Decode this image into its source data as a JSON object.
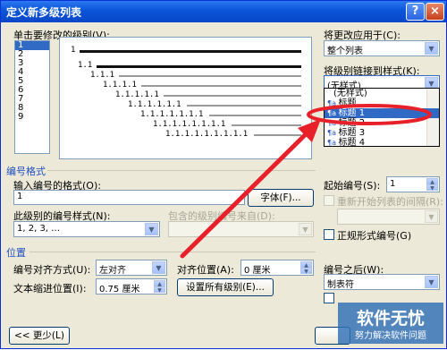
{
  "window": {
    "title": "定义新多级列表",
    "help_label": "?",
    "close_label": "×"
  },
  "level_list": {
    "label": "单击要修改的级别(V):",
    "levels": [
      "1",
      "2",
      "3",
      "4",
      "5",
      "6",
      "7",
      "8",
      "9"
    ],
    "selected": "1"
  },
  "preview": {
    "rows": [
      {
        "text": "1"
      },
      {
        "text": "1.1"
      },
      {
        "text": "1.1.1"
      },
      {
        "text": "1.1.1.1"
      },
      {
        "text": "1.1.1.1.1"
      },
      {
        "text": "1.1.1.1.1.1"
      },
      {
        "text": "1.1.1.1.1.1.1"
      },
      {
        "text": "1.1.1.1.1.1.1.1"
      },
      {
        "text": "1.1.1.1.1.1.1.1.1"
      }
    ]
  },
  "apply_to": {
    "label": "将更改应用于(C):",
    "value": "整个列表"
  },
  "link_style": {
    "label": "将级别链接到样式(K):",
    "value": "(无样式)",
    "options": [
      {
        "label": "(无样式)",
        "icon": ""
      },
      {
        "label": "标题",
        "icon": "paragraph-style-icon"
      },
      {
        "label": "标题 1",
        "icon": "paragraph-style-icon"
      },
      {
        "label": "标题 2",
        "icon": "paragraph-style-icon"
      },
      {
        "label": "标题 3",
        "icon": "paragraph-style-icon"
      },
      {
        "label": "标题 4",
        "icon": "paragraph-style-icon"
      }
    ],
    "selected_index": 2
  },
  "number_format": {
    "section_label": "编号格式",
    "enter_format_label": "输入编号的格式(O):",
    "enter_format_value": "1",
    "font_button": "字体(F)...",
    "number_style_label": "此级别的编号样式(N):",
    "number_style_value": "1, 2, 3, …",
    "include_level_label": "包含的级别编号来自(D):",
    "start_at_label": "起始编号(S):",
    "start_at_value": "1",
    "restart_label": "重新开始列表的间隔(R):",
    "legal_style_label": "正规形式编号(G)"
  },
  "position": {
    "section_label": "位置",
    "alignment_label": "编号对齐方式(U):",
    "alignment_value": "左对齐",
    "aligned_at_label": "对齐位置(A):",
    "aligned_at_value": "0 厘米",
    "follow_with_label": "编号之后(W):",
    "follow_with_value": "制表符",
    "indent_label": "文本缩进位置(I):",
    "indent_value": "0.75 厘米",
    "set_all_button": "设置所有级别(E)..."
  },
  "footer": {
    "less_button": "<< 更少(L)"
  },
  "watermark": {
    "title": "软件无忧",
    "subtitle": "努力解决软件问题"
  },
  "colors": {
    "titlebar": "#0a54d8",
    "section_text": "#1f4fbf",
    "selection": "#316ac5",
    "annotation": "#e8202a"
  }
}
